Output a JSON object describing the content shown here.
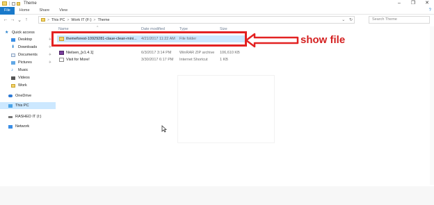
{
  "window": {
    "title": "Theme",
    "minimize": "–",
    "maximize": "❐",
    "close": "✕"
  },
  "ribbon": {
    "tabs": [
      "File",
      "Home",
      "Share",
      "View"
    ],
    "help": "?"
  },
  "address": {
    "back": "←",
    "forward": "→",
    "recent": "⌄",
    "up": "↑",
    "crumbs": [
      "This PC",
      "Work IT (F:)",
      "Theme"
    ],
    "sep": ">",
    "dropdown": "⌄",
    "refresh": "↻",
    "search_placeholder": "Search Theme"
  },
  "nav": {
    "items": [
      {
        "label": "Quick access",
        "icon": "star-icon"
      },
      {
        "label": "Desktop",
        "icon": "desktop-icon",
        "pinned": true
      },
      {
        "label": "Downloads",
        "icon": "download-icon",
        "pinned": true
      },
      {
        "label": "Documents",
        "icon": "documents-icon",
        "pinned": true
      },
      {
        "label": "Pictures",
        "icon": "pictures-icon",
        "pinned": true
      },
      {
        "label": "Music",
        "icon": "music-icon"
      },
      {
        "label": "Videos",
        "icon": "videos-icon"
      },
      {
        "label": "Work",
        "icon": "folder-icon"
      },
      {
        "label": "OneDrive",
        "icon": "cloud-icon"
      },
      {
        "label": "This PC",
        "icon": "computer-icon",
        "selected": true
      },
      {
        "label": "RASHED IT (I:)",
        "icon": "drive-icon"
      },
      {
        "label": "Network",
        "icon": "network-icon"
      }
    ],
    "pin_glyph": "✈"
  },
  "columns": {
    "name": "Name",
    "date": "Date modified",
    "type": "Type",
    "size": "Size",
    "sort_arrow": "^"
  },
  "files": [
    {
      "name": "themeforest-10929281-claue-clean-mini...",
      "date": "4/21/2017 11:22 AM",
      "type": "File folder",
      "size": "",
      "icon": "folder-icon",
      "selected": true
    },
    {
      "name": "Nielsen_[v1.4.1]",
      "date": "6/3/2017 3:14 PM",
      "type": "WinRAR ZIP archive",
      "size": "106,610 KB",
      "icon": "archive-icon"
    },
    {
      "name": "Visit for More!",
      "date": "3/30/2017 6:17 PM",
      "type": "Internet Shortcut",
      "size": "1 KB",
      "icon": "shortcut-icon"
    }
  ],
  "annotation": {
    "text": "show file",
    "color": "#d42020"
  },
  "colors": {
    "accent": "#1979ca",
    "selection": "#cce8ff",
    "highlight": "#e32222"
  }
}
